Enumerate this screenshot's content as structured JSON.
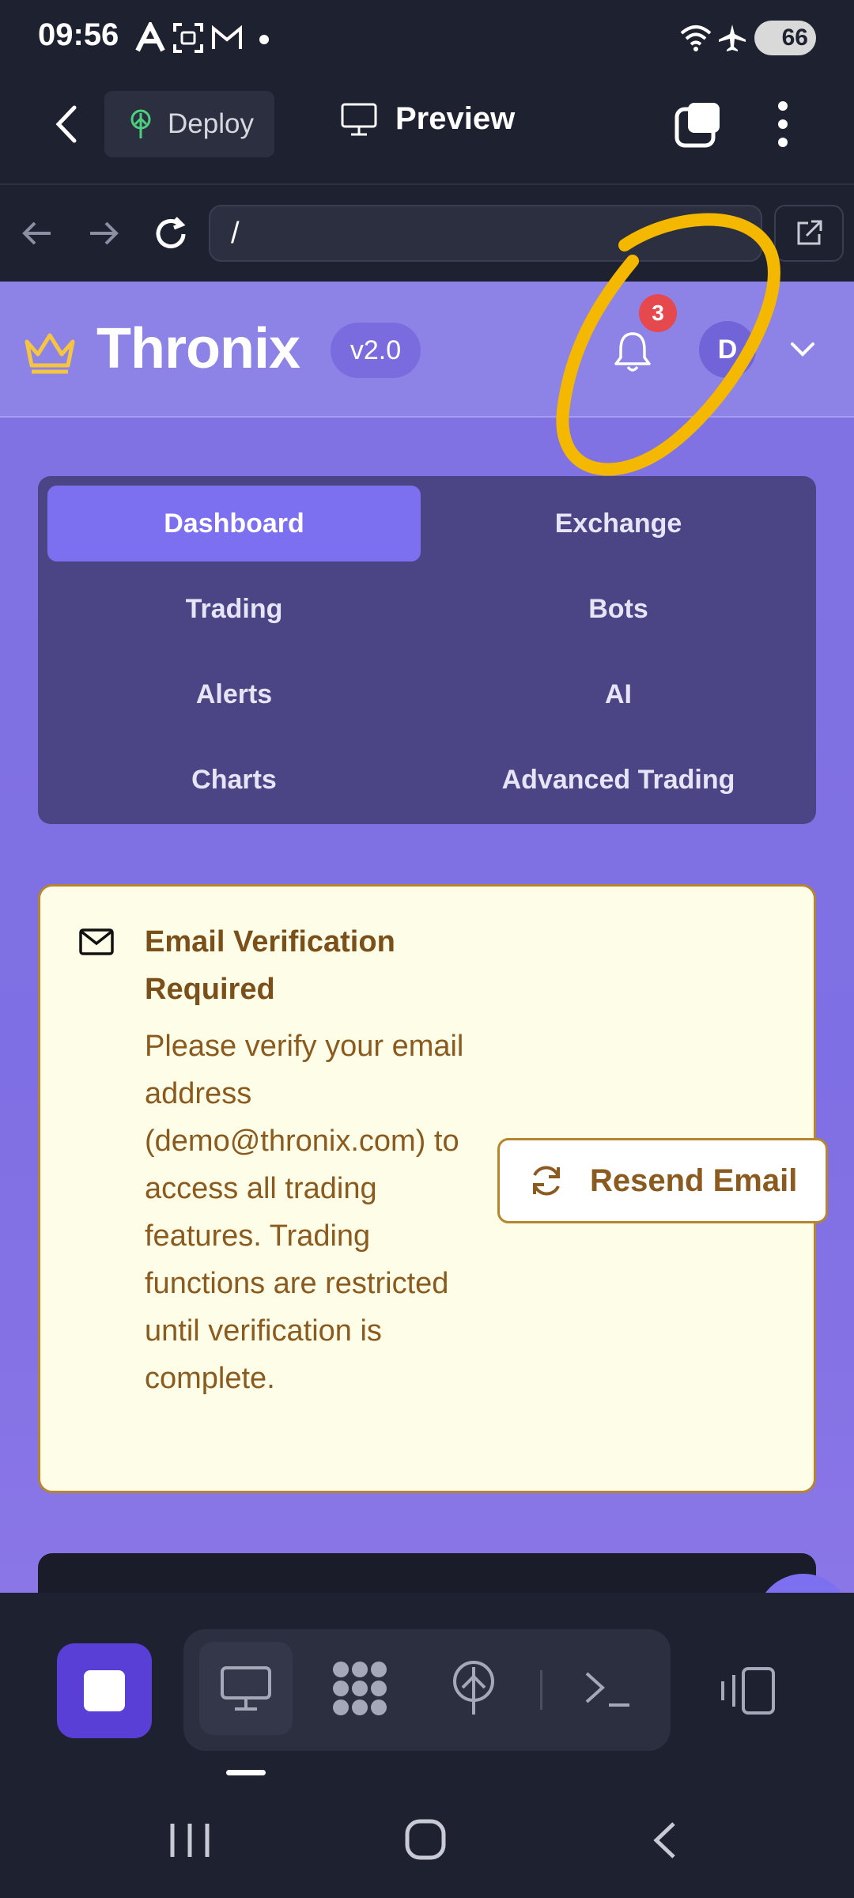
{
  "status_bar": {
    "time": "09:56",
    "battery": "66",
    "icons": [
      "text-a-icon",
      "screenshot-icon",
      "gmail-icon",
      "dot-icon",
      "wifi-icon",
      "airplane-icon",
      "battery-icon"
    ]
  },
  "app_bar": {
    "back_icon": "chevron-left-icon",
    "deploy_label": "Deploy",
    "preview_label": "Preview",
    "tabs_icon": "tabs-icon",
    "more_icon": "more-vertical-icon"
  },
  "browser": {
    "url": "/",
    "icons": [
      "arrow-left-icon",
      "arrow-right-icon",
      "reload-icon",
      "external-link-icon"
    ]
  },
  "site": {
    "brand": "Thronix",
    "version": "v2.0",
    "notification_count": "3",
    "avatar_initial": "D"
  },
  "nav": {
    "items": [
      {
        "label": "Dashboard",
        "active": true
      },
      {
        "label": "Exchange"
      },
      {
        "label": "Trading"
      },
      {
        "label": "Bots"
      },
      {
        "label": "Alerts"
      },
      {
        "label": "AI"
      },
      {
        "label": "Charts"
      },
      {
        "label": "Advanced Trading"
      }
    ]
  },
  "email_alert": {
    "title": "Email Verification Required",
    "body": "Please verify your email address (demo@thronix.com) to access all trading features. Trading functions are restricted until verification is complete.",
    "button_label": "Resend Email"
  },
  "bottom_toolbar": {
    "icons": [
      "stop-icon",
      "desktop-icon",
      "apps-icon",
      "deploy-icon",
      "terminal-icon",
      "devices-icon"
    ]
  },
  "colors": {
    "accent": "#7c6ff0",
    "app_bg": "#1e2130",
    "warning_border": "#b6852e",
    "warning_bg": "#fefde8",
    "annotation": "#f5b800"
  }
}
